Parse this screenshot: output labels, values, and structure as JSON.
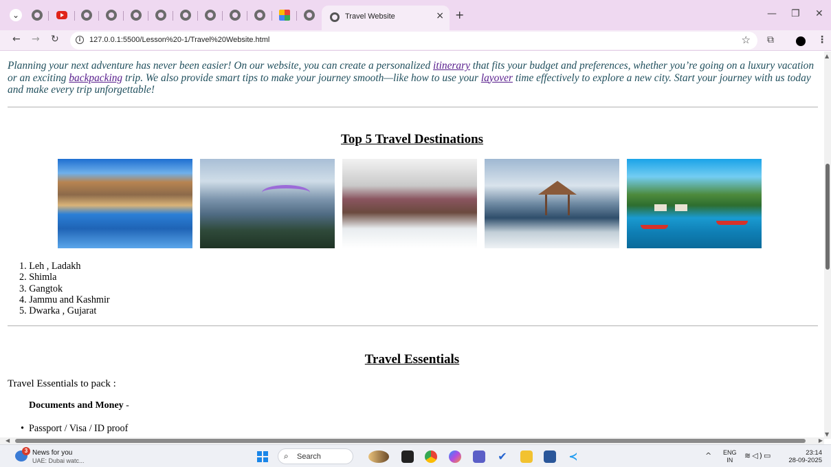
{
  "browser": {
    "active_tab_title": "Travel Website",
    "url": "127.0.0.1:5500/Lesson%20-1/Travel%20Website.html",
    "new_tab_symbol": "+",
    "close_tab_symbol": "×"
  },
  "page": {
    "intro": {
      "part1": "Planning your next adventure has never been easier! On our website, you can create a personalized ",
      "link1": "itinerary",
      "part2": " that fits your budget and preferences, whether you’re going on a luxury vacation or an exciting ",
      "link2": "backpacking",
      "part3": " trip. We also provide smart tips to make your journey smooth—like how to use your ",
      "link3": "layover",
      "part4": " time effectively to explore a new city. Start your journey with us today and make every trip unforgettable!"
    },
    "destinations_title": "Top 5 Travel Destinations",
    "destinations": [
      "1. Leh , Ladakh",
      "2. Shimla",
      "3. Gangtok",
      "4. Jammu and Kashmir",
      "5. Dwarka , Gujarat"
    ],
    "essentials_title": "Travel Essentials",
    "essentials_intro": "Travel Essentials to pack :",
    "documents_heading": "Documents and Money",
    "documents_dash": " -",
    "documents_items": [
      "Passport / Visa / ID proof"
    ]
  },
  "taskbar": {
    "news_badge": "3",
    "news_title": "News for you",
    "news_sub": "UAE: Dubai watc...",
    "search_label": "Search",
    "lang_line1": "ENG",
    "lang_line2": "IN",
    "time": "23:14",
    "date": "28-09-2025"
  },
  "colors": {
    "tab_strip": "#efd9f1",
    "intro_text": "#1f4e5c",
    "visited_link": "#551a8b"
  }
}
